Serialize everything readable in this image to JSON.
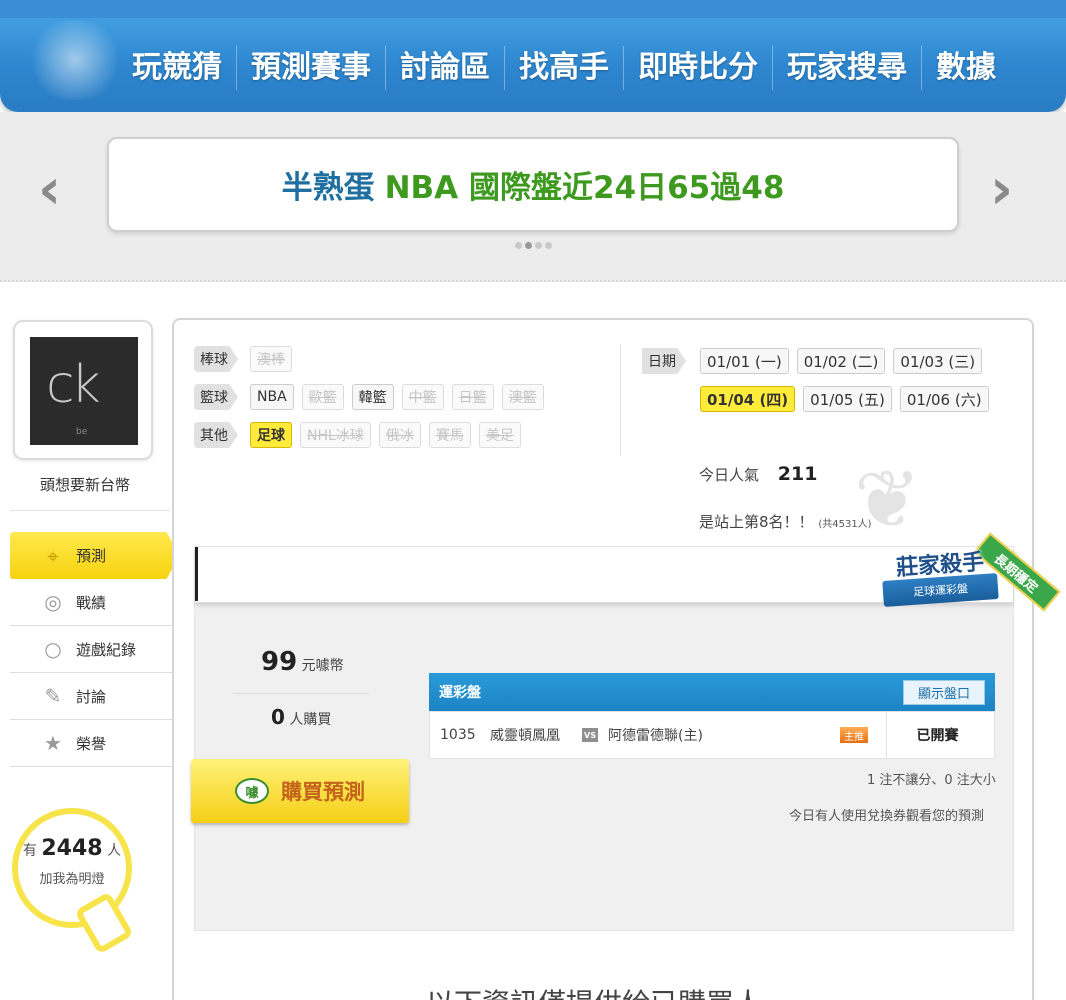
{
  "nav": {
    "items": [
      "玩競猜",
      "預測賽事",
      "討論區",
      "找高手",
      "即時比分",
      "玩家搜尋",
      "數據"
    ]
  },
  "banner": {
    "part1": "半熟蛋",
    "part2": "NBA 國際盤近24日65過48",
    "prev_icon": "chevron-left-icon",
    "next_icon": "chevron-right-icon"
  },
  "profile": {
    "avatar_text": "ck",
    "avatar_sub": "be",
    "username": "頭想要新台幣",
    "fans_prefix": "有",
    "fans_count": "2448",
    "fans_suffix": "人",
    "fans_line2": "加我為明燈"
  },
  "menu": [
    {
      "label": "預測",
      "icon": "crosshair-icon"
    },
    {
      "label": "戰績",
      "icon": "spiral-icon"
    },
    {
      "label": "遊戲紀錄",
      "icon": "circle-icon"
    },
    {
      "label": "討論",
      "icon": "pen-icon"
    },
    {
      "label": "榮譽",
      "icon": "medal-icon"
    }
  ],
  "filters": {
    "baseball_label": "棒球",
    "baseball": [
      "澳棒"
    ],
    "basketball_label": "籃球",
    "basketball": [
      "NBA",
      "歐籃",
      "韓籃",
      "中籃",
      "日籃",
      "澳籃"
    ],
    "other_label": "其他",
    "other": [
      "足球",
      "NHL冰球",
      "俄冰",
      "賽馬",
      "美足"
    ]
  },
  "dates": {
    "label": "日期",
    "row1": [
      "01/01 (一)",
      "01/02 (二)",
      "01/03 (三)"
    ],
    "row2": [
      "01/04 (四)",
      "01/05 (五)",
      "01/06 (六)"
    ]
  },
  "stats": {
    "pop_label": "今日人氣",
    "pop_value": "211",
    "rank_text": "是站上第8名！！",
    "rank_total": "(共4531人)"
  },
  "badge": {
    "title": "莊家殺手",
    "ribbon": "足球運彩盤",
    "sash": "長期穩定"
  },
  "purchase": {
    "price": "99",
    "price_unit": "元噱幣",
    "buyers": "0",
    "buyers_unit": "人購買",
    "buy_label": "購買預測",
    "coin_label": "噱"
  },
  "table": {
    "title": "運彩盤",
    "show_label": "顯示盤口",
    "row": {
      "id": "1035",
      "home": "威靈頓鳳凰",
      "vs": "VS",
      "away": "阿德雷德聯(主)",
      "tag": "主推",
      "status": "已開賽"
    }
  },
  "summary": "1 注不讓分、0 注大小",
  "voucher": "今日有人使用兌換券觀看您的預測",
  "cutoff_text": "以下資訊僅提供給已購買人"
}
